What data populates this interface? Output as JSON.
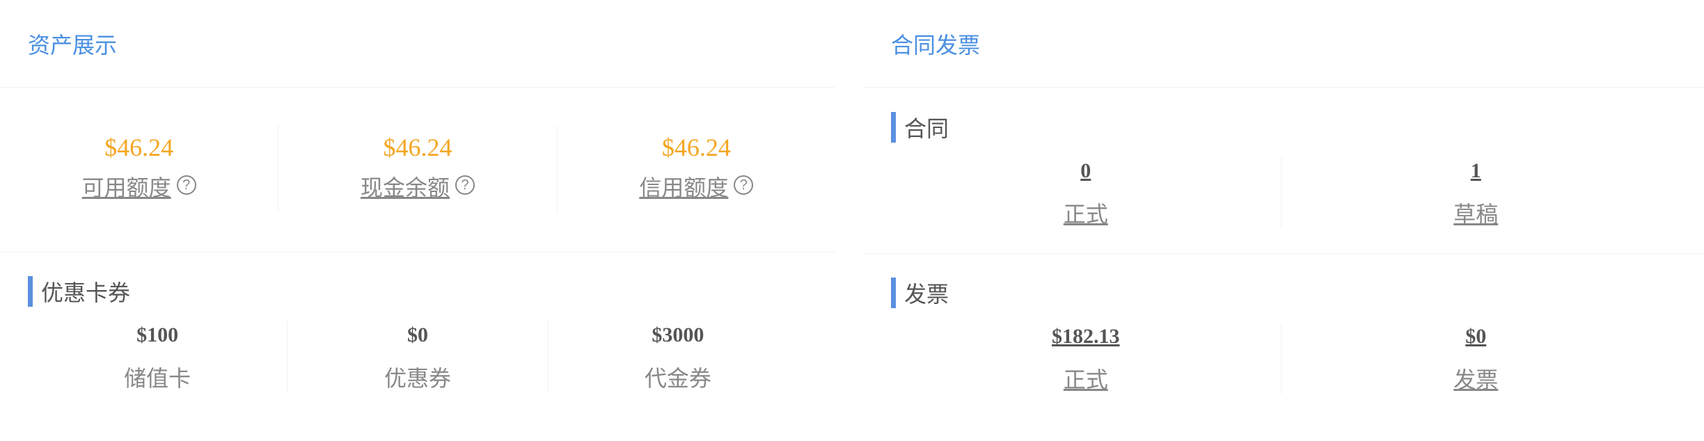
{
  "assets": {
    "title": "资产展示",
    "items": [
      {
        "amount": "$46.24",
        "label": "可用额度",
        "help": "?"
      },
      {
        "amount": "$46.24",
        "label": "现金余额",
        "help": "?"
      },
      {
        "amount": "$46.24",
        "label": "信用额度",
        "help": "?"
      }
    ],
    "coupons": {
      "title": "优惠卡券",
      "items": [
        {
          "value": "$100",
          "label": "储值卡"
        },
        {
          "value": "$0",
          "label": "优惠券"
        },
        {
          "value": "$3000",
          "label": "代金券"
        }
      ]
    }
  },
  "contracts_invoices": {
    "title": "合同发票",
    "contracts": {
      "title": "合同",
      "items": [
        {
          "value": "0",
          "label": "正式"
        },
        {
          "value": "1",
          "label": "草稿"
        }
      ]
    },
    "invoices": {
      "title": "发票",
      "items": [
        {
          "value": "$182.13",
          "label": "正式"
        },
        {
          "value": "$0",
          "label": "发票"
        }
      ]
    }
  },
  "colors": {
    "title_blue": "#4a90e2",
    "accent_bar": "#5b8fe0",
    "amount_orange": "#f5a623",
    "text_gray": "#888888"
  }
}
